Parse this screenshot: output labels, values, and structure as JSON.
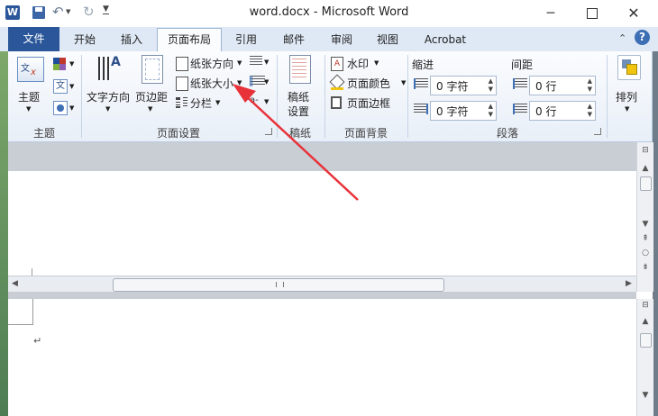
{
  "window": {
    "title": "word.docx - Microsoft Word",
    "app_icon": "W"
  },
  "tabs": [
    "文件",
    "开始",
    "插入",
    "页面布局",
    "引用",
    "邮件",
    "审阅",
    "视图",
    "Acrobat"
  ],
  "ribbon": {
    "themes": {
      "button": "主题",
      "group": "主题"
    },
    "page_setup": {
      "text_direction": "文字方向",
      "margins": "页边距",
      "orientation": "纸张方向",
      "size": "纸张大小",
      "columns": "分栏",
      "group": "页面设置"
    },
    "manuscript": {
      "button_line1": "稿纸",
      "button_line2": "设置",
      "group": "稿纸"
    },
    "page_background": {
      "watermark": "水印",
      "page_color": "页面颜色",
      "page_borders": "页面边框",
      "group": "页面背景"
    },
    "paragraph": {
      "indent_label": "缩进",
      "spacing_label": "间距",
      "indent_left": "0 字符",
      "indent_right": "0 字符",
      "spacing_before": "0 行",
      "spacing_after": "0 行",
      "group": "段落"
    },
    "arrange": {
      "button": "排列"
    }
  },
  "document": {
    "paragraph_mark": "↵"
  },
  "colors": {
    "file_tab": "#2b579a",
    "accent": "#e8323a",
    "ribbon_bg": "#fbfcfe",
    "help": "#3c6fb4"
  }
}
